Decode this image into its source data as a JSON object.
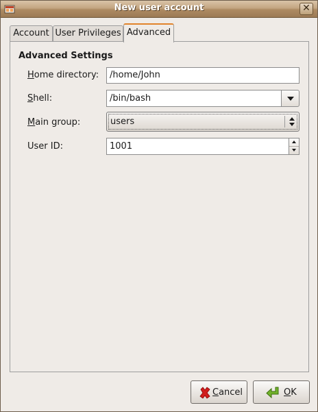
{
  "window": {
    "title": "New user account",
    "close_symbol": "✕"
  },
  "tabs": [
    {
      "label": "Account",
      "active": false
    },
    {
      "label": "User Privileges",
      "active": false
    },
    {
      "label": "Advanced",
      "active": true
    }
  ],
  "advanced": {
    "section_title": "Advanced Settings",
    "home_directory": {
      "label_prefix": "",
      "label_mnemonic": "H",
      "label_rest": "ome directory:",
      "value": "/home/John"
    },
    "shell": {
      "label_mnemonic": "S",
      "label_rest": "hell:",
      "value": "/bin/bash"
    },
    "main_group": {
      "label_mnemonic": "M",
      "label_rest": "ain group:",
      "value": "users"
    },
    "user_id": {
      "label": "User ID:",
      "value": "1001"
    }
  },
  "buttons": {
    "cancel": {
      "mnemonic": "C",
      "rest": "ancel",
      "icon": "cancel-icon",
      "icon_color": "#cc0000"
    },
    "ok": {
      "mnemonic": "O",
      "rest": "K",
      "icon": "ok-arrow-icon",
      "icon_color": "#4e9a06"
    }
  },
  "colors": {
    "titlebar": "#b08d62",
    "active_tab_accent": "#e1832a",
    "window_bg": "#efebe7"
  }
}
